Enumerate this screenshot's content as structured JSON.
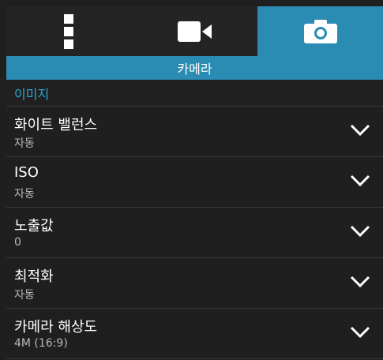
{
  "tabs": [
    {
      "icon": "menu-icon"
    },
    {
      "icon": "video-camera-icon"
    },
    {
      "icon": "camera-icon",
      "active": true
    }
  ],
  "header": {
    "strip_title": "카메라"
  },
  "section": {
    "title": "이미지"
  },
  "settings": [
    {
      "title": "화이트 밸런스",
      "value": "자동"
    },
    {
      "title": "ISO",
      "value": "자동"
    },
    {
      "title": "노출값",
      "value": "0"
    },
    {
      "title": "최적화",
      "value": "자동"
    },
    {
      "title": "카메라 해상도",
      "value": "4M (16:9)"
    }
  ],
  "colors": {
    "accent": "#2a8bb3",
    "section_text": "#2fa6d6",
    "background": "#1f1f1f"
  }
}
